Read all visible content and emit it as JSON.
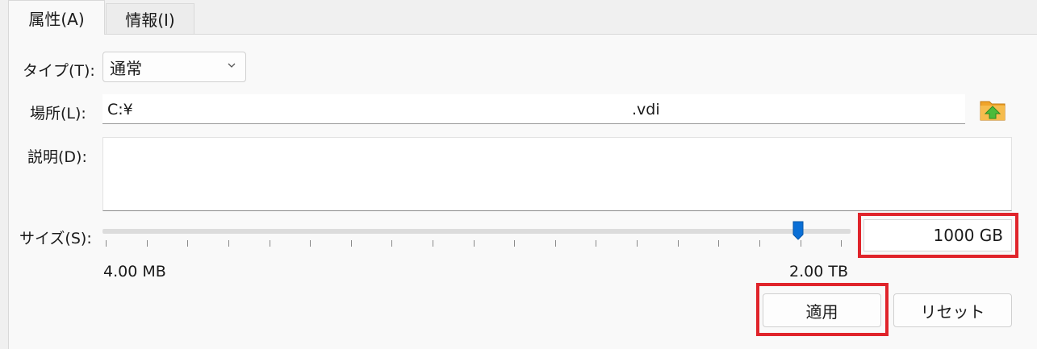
{
  "tabs": [
    {
      "label": "属性(A)"
    },
    {
      "label": "情報(I)"
    }
  ],
  "type_row": {
    "label": "タイプ(T):",
    "value": "通常"
  },
  "location_row": {
    "label": "場所(L):",
    "value_prefix": "C:¥",
    "value_suffix": ".vdi"
  },
  "description_row": {
    "label": "説明(D):",
    "value": ""
  },
  "size_row": {
    "label": "サイズ(S):",
    "min_label": "4.00 MB",
    "max_label": "2.00 TB",
    "value": "1000 GB",
    "slider_fraction": 0.93
  },
  "buttons": {
    "apply": "適用",
    "reset": "リセット"
  },
  "colors": {
    "highlight": "#e0242b",
    "slider_thumb": "#0a6fd6",
    "folder": "#f0a42a"
  },
  "icons": {
    "folder": "folder-icon",
    "chevron": "chevron-down-icon"
  }
}
